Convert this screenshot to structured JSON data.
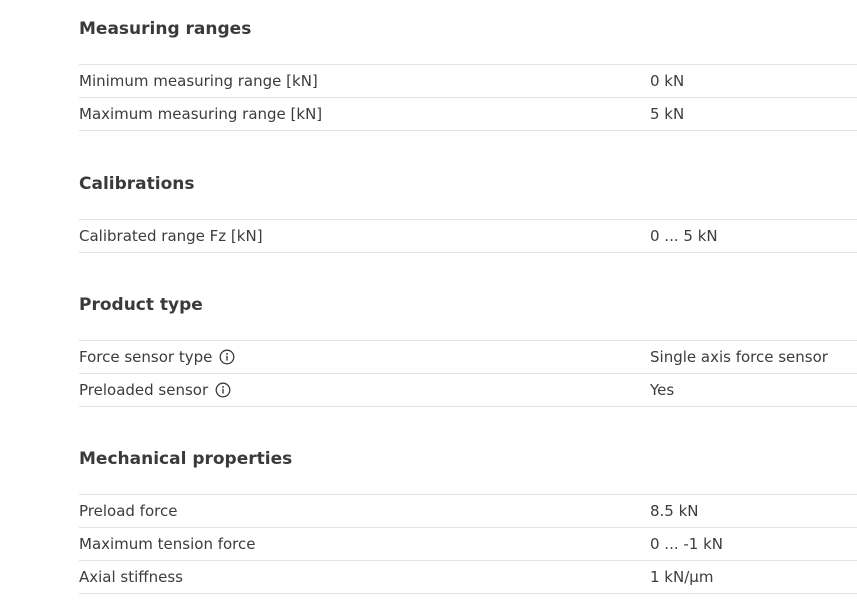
{
  "sections": [
    {
      "title": "Measuring ranges",
      "rows": [
        {
          "label": "Minimum measuring range [kN]",
          "value": "0 kN"
        },
        {
          "label": "Maximum measuring range [kN]",
          "value": "5 kN"
        }
      ]
    },
    {
      "title": "Calibrations",
      "rows": [
        {
          "label": "Calibrated range Fz [kN]",
          "value": "0 ... 5 kN"
        }
      ]
    },
    {
      "title": "Product type",
      "rows": [
        {
          "label": "Force sensor type",
          "value": "Single axis force sensor",
          "icon": "info-icon"
        },
        {
          "label": "Preloaded sensor",
          "value": "Yes",
          "icon": "info-icon"
        }
      ]
    },
    {
      "title": "Mechanical properties",
      "rows": [
        {
          "label": "Preload force",
          "value": "8.5 kN"
        },
        {
          "label": "Maximum tension force",
          "value": "0 ... -1 kN"
        },
        {
          "label": "Axial stiffness",
          "value": "1 kN/μm"
        }
      ]
    }
  ]
}
